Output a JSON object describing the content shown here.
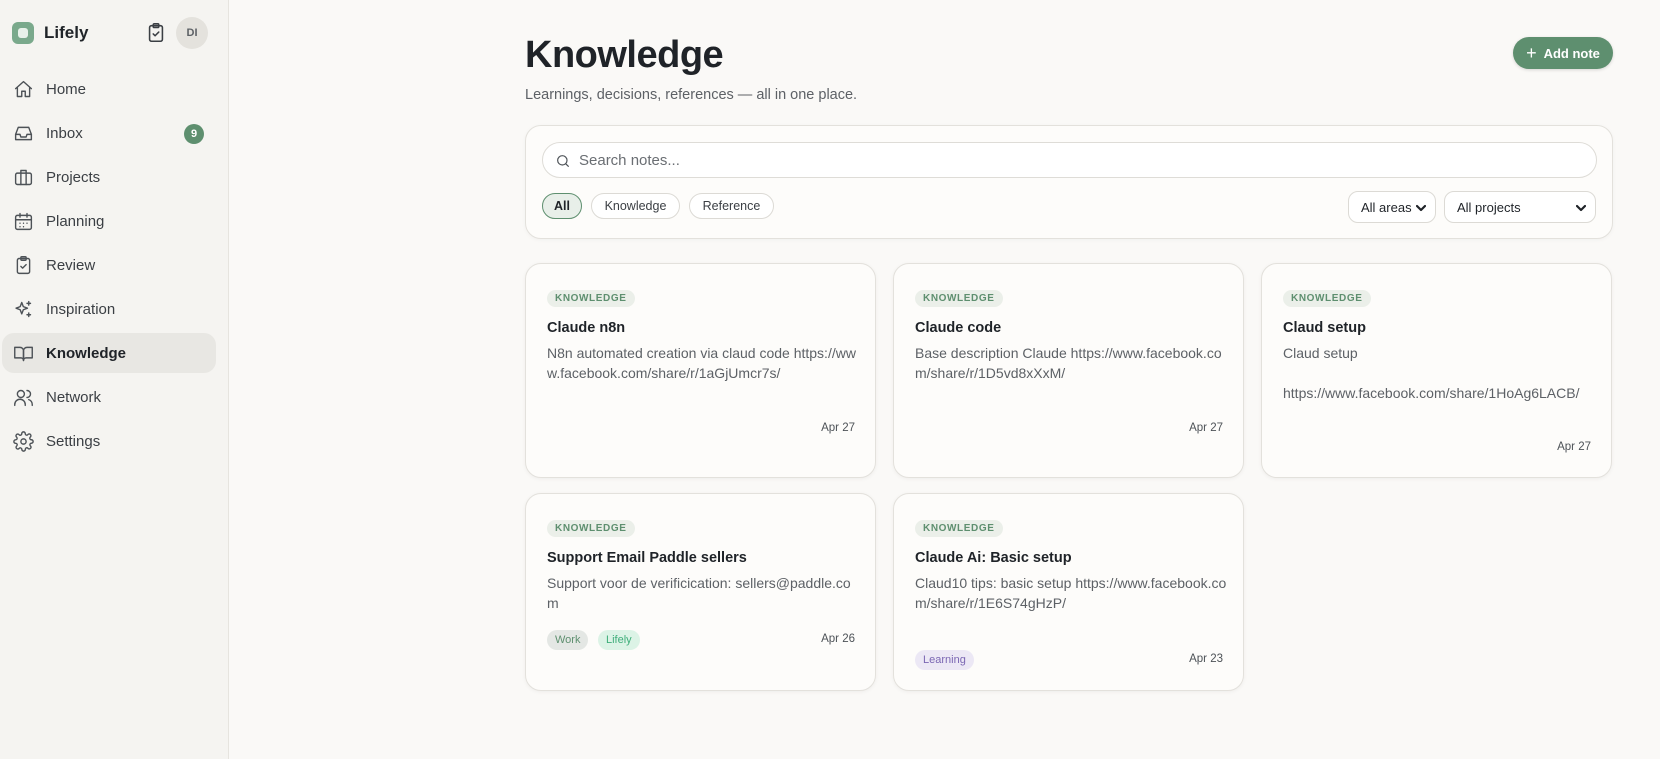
{
  "sidebar": {
    "brand": "Lifely",
    "avatar": "DI",
    "items": [
      {
        "label": "Home",
        "icon": "home-icon"
      },
      {
        "label": "Inbox",
        "icon": "inbox-icon",
        "badge": "9"
      },
      {
        "label": "Projects",
        "icon": "briefcase-icon"
      },
      {
        "label": "Planning",
        "icon": "calendar-icon"
      },
      {
        "label": "Review",
        "icon": "clipboard-check-icon"
      },
      {
        "label": "Inspiration",
        "icon": "sparkles-icon"
      },
      {
        "label": "Knowledge",
        "icon": "book-open-icon",
        "active": true
      },
      {
        "label": "Network",
        "icon": "users-icon"
      },
      {
        "label": "Settings",
        "icon": "gear-icon"
      }
    ]
  },
  "header": {
    "title": "Knowledge",
    "subtitle": "Learnings, decisions, references — all in one place.",
    "add_label": "Add note"
  },
  "filters": {
    "search_placeholder": "Search notes...",
    "search_value": "",
    "chips": [
      "All",
      "Knowledge",
      "Reference"
    ],
    "active_chip": "All",
    "area_select": "All areas",
    "project_select": "All projects"
  },
  "notes": [
    {
      "kind": "KNOWLEDGE",
      "title": "Claude n8n",
      "body": "N8n automated creation via claud code https://www.facebook.com/share/r/1aGjUmcr7s/",
      "date": "Apr 27",
      "tags": []
    },
    {
      "kind": "KNOWLEDGE",
      "title": "Claude code",
      "body": "Base description Claude https://www.facebook.com/share/r/1D5vd8xXxM/",
      "date": "Apr 27",
      "tags": []
    },
    {
      "kind": "KNOWLEDGE",
      "title": "Claud setup",
      "body": "Claud setup\n\nhttps://www.facebook.com/share/1HoAg6LACB/",
      "date": "Apr 27",
      "tags": []
    },
    {
      "kind": "KNOWLEDGE",
      "title": "Support Email Paddle sellers",
      "body": "Support voor de verificication: sellers@paddle.com",
      "date": "Apr 26",
      "tags": [
        "Work",
        "Lifely"
      ]
    },
    {
      "kind": "KNOWLEDGE",
      "title": "Claude Ai: Basic setup",
      "body": "Claud10 tips: basic setup https://www.facebook.com/share/r/1E6S74gHzP/",
      "date": "Apr 23",
      "tags": [
        "Learning"
      ]
    }
  ],
  "colors": {
    "accent": "#5e8f6f",
    "tag_work_bg": "#e4e7e4",
    "tag_lifely_bg": "#dcf3e6",
    "tag_learning_bg": "#ece8f5"
  }
}
